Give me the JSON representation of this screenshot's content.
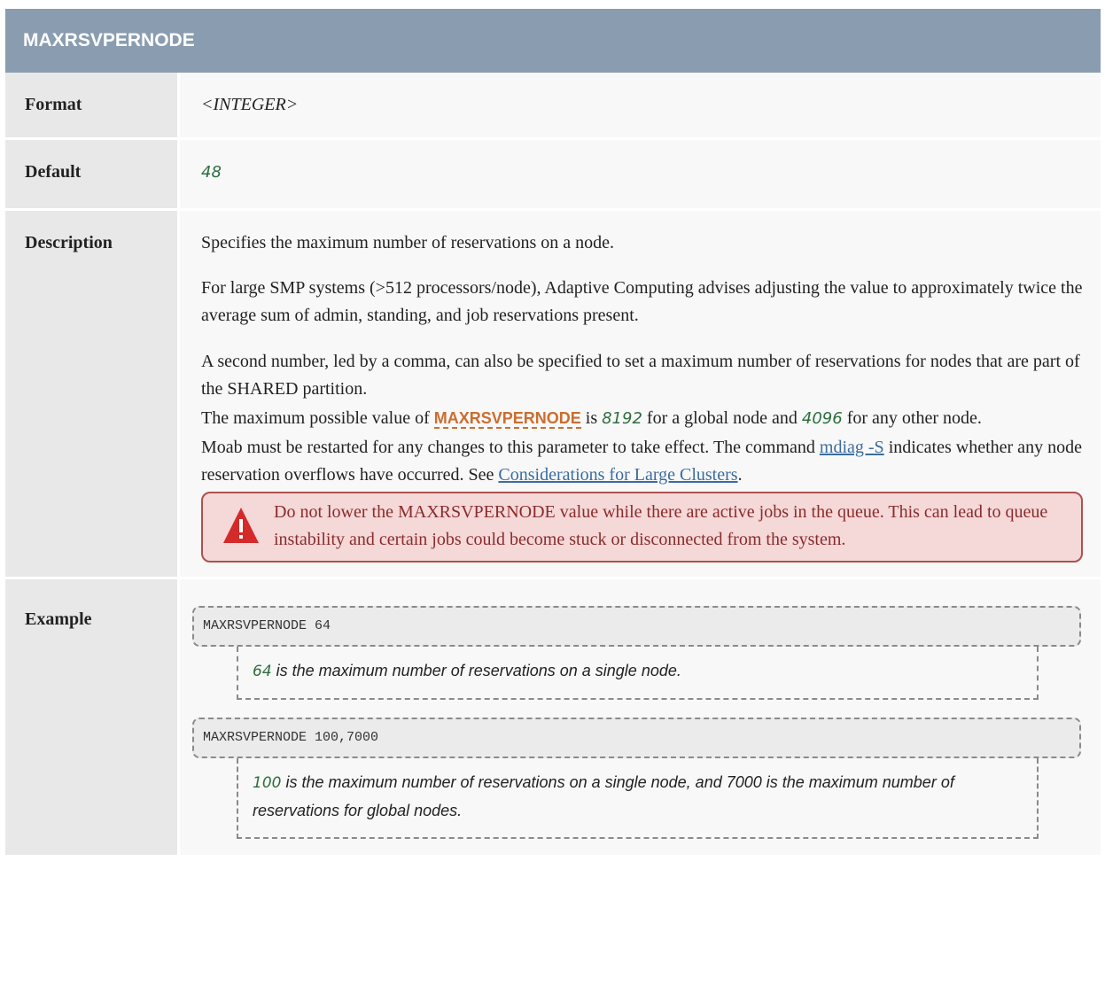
{
  "header": {
    "title": "MAXRSVPERNODE"
  },
  "rows": {
    "format": {
      "label": "Format",
      "value": "<INTEGER>"
    },
    "default": {
      "label": "Default",
      "value": "48"
    },
    "description": {
      "label": "Description",
      "p1": "Specifies the maximum number of reservations on a node.",
      "p2": "For large SMP systems (>512 processors/node), Adaptive Computing advises adjusting the value to approximately twice the average sum of admin, standing, and job reservations present.",
      "p3": "A second number, led by a comma, can also be specified to set a maximum number of reservations for nodes that are part of the SHARED partition.",
      "p4_pre": "The maximum possible value of ",
      "p4_link": "MAXRSVPERNODE",
      "p4_mid1": " is ",
      "p4_val1": "8192",
      "p4_mid2": " for a global node and ",
      "p4_val2": "4096",
      "p4_post": " for any other node.",
      "p5_pre": "Moab must be restarted for any changes to this parameter to take effect. The command ",
      "p5_link1": "mdiag -S",
      "p5_mid": " indicates whether any node reservation overflows have occurred. See ",
      "p5_link2": "Considerations for Large Clusters",
      "p5_post": ".",
      "warning": {
        "icon": "warning-triangle-icon",
        "color": "#d42a2a",
        "text": "Do not lower the MAXRSVPERNODE value while there are active jobs in the queue. This can lead to queue instability and certain jobs could become stuck or disconnected from the system."
      }
    },
    "example": {
      "label": "Example",
      "code1": "MAXRSVPERNODE 64",
      "explain1_num": "64",
      "explain1_text": " is the maximum number of reservations on a single node.",
      "code2": "MAXRSVPERNODE 100,7000",
      "explain2_num": "100",
      "explain2_text": " is the maximum number of reservations on a single node, and 7000 is the maximum number of reservations for global nodes."
    }
  }
}
